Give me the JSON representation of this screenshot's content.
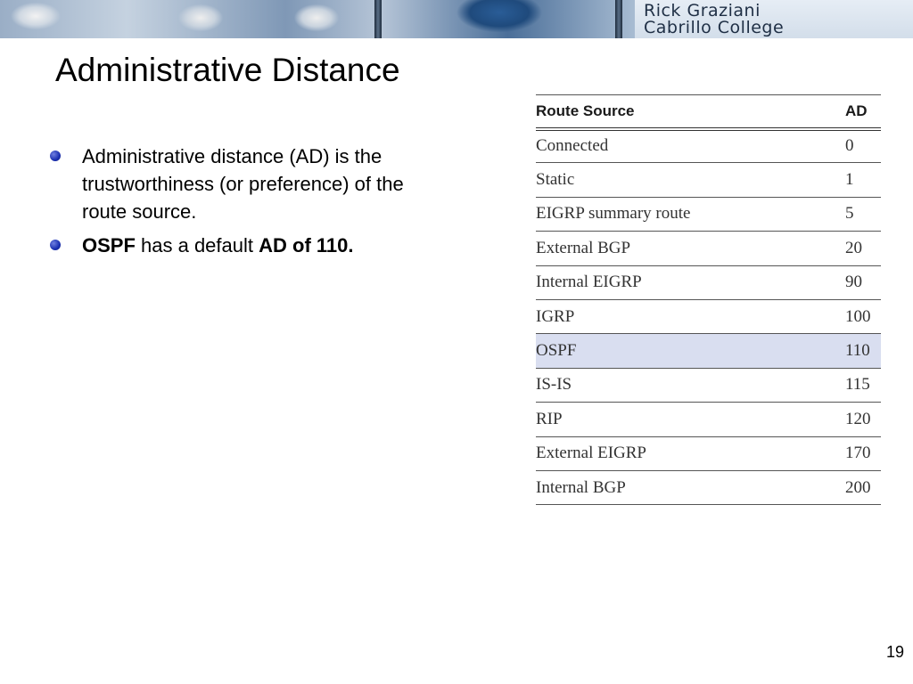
{
  "header": {
    "author": "Rick Graziani",
    "institution": "Cabrillo College"
  },
  "slide": {
    "title": "Administrative Distance",
    "page_number": "19"
  },
  "bullets": [
    {
      "text": "Administrative distance (AD) is the trustworthiness (or preference) of the route source."
    },
    {
      "bold1": "OSPF",
      "text": " has a default ",
      "bold2": "AD of 110."
    }
  ],
  "table": {
    "headers": {
      "source": "Route Source",
      "ad": "AD"
    },
    "highlight_color": "#d9def0",
    "rows": [
      {
        "source": "Connected",
        "ad": "0"
      },
      {
        "source": "Static",
        "ad": "1"
      },
      {
        "source": "EIGRP summary route",
        "ad": "5"
      },
      {
        "source": "External BGP",
        "ad": "20"
      },
      {
        "source": "Internal EIGRP",
        "ad": "90"
      },
      {
        "source": "IGRP",
        "ad": "100"
      },
      {
        "source": "OSPF",
        "ad": "110",
        "highlighted": true
      },
      {
        "source": "IS-IS",
        "ad": "115"
      },
      {
        "source": "RIP",
        "ad": "120"
      },
      {
        "source": "External EIGRP",
        "ad": "170"
      },
      {
        "source": "Internal BGP",
        "ad": "200"
      }
    ]
  }
}
